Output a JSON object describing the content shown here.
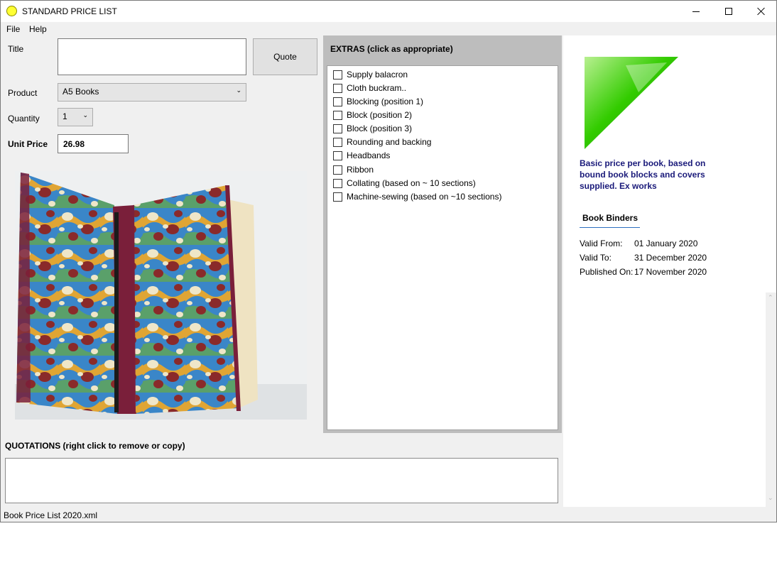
{
  "window": {
    "title": "STANDARD PRICE LIST"
  },
  "menu": {
    "items": [
      "File",
      "Help"
    ]
  },
  "form": {
    "title_label": "Title",
    "title_value": "",
    "quote_button": "Quote",
    "product_label": "Product",
    "product_value": "A5 Books",
    "quantity_label": "Quantity",
    "quantity_value": "1",
    "unit_price_label": "Unit Price",
    "unit_price_value": "26.98"
  },
  "extras": {
    "header": "EXTRAS (click as appropriate)",
    "items": [
      {
        "label": "Supply balacron",
        "checked": false
      },
      {
        "label": "Cloth buckram..",
        "checked": false
      },
      {
        "label": "Blocking (position 1)",
        "checked": false
      },
      {
        "label": "Block (position 2)",
        "checked": false
      },
      {
        "label": "Block (position 3)",
        "checked": false
      },
      {
        "label": "Rounding and backing",
        "checked": false
      },
      {
        "label": "Headbands",
        "checked": false
      },
      {
        "label": "Ribbon",
        "checked": false
      },
      {
        "label": "Collating (based on ~ 10 sections)",
        "checked": false
      },
      {
        "label": "Machine-sewing (based on ~10 sections)",
        "checked": false
      }
    ]
  },
  "info": {
    "blurb": "Basic price per book, based on bound book blocks and covers supplied. Ex works",
    "company": "Book Binders",
    "valid_from_label": "Valid From:",
    "valid_from": "01 January 2020",
    "valid_to_label": "Valid To:",
    "valid_to": "31 December 2020",
    "published_label": "Published On:",
    "published": "17 November 2020"
  },
  "quotations": {
    "header": "QUOTATIONS (right click to remove or copy)"
  },
  "status": {
    "file": "Book Price List 2020.xml"
  },
  "colors": {
    "blurb_text": "#1a1a7a",
    "underline": "#2c6fbf",
    "logo_green": "#33cc00",
    "app_icon": "#ffff33"
  }
}
